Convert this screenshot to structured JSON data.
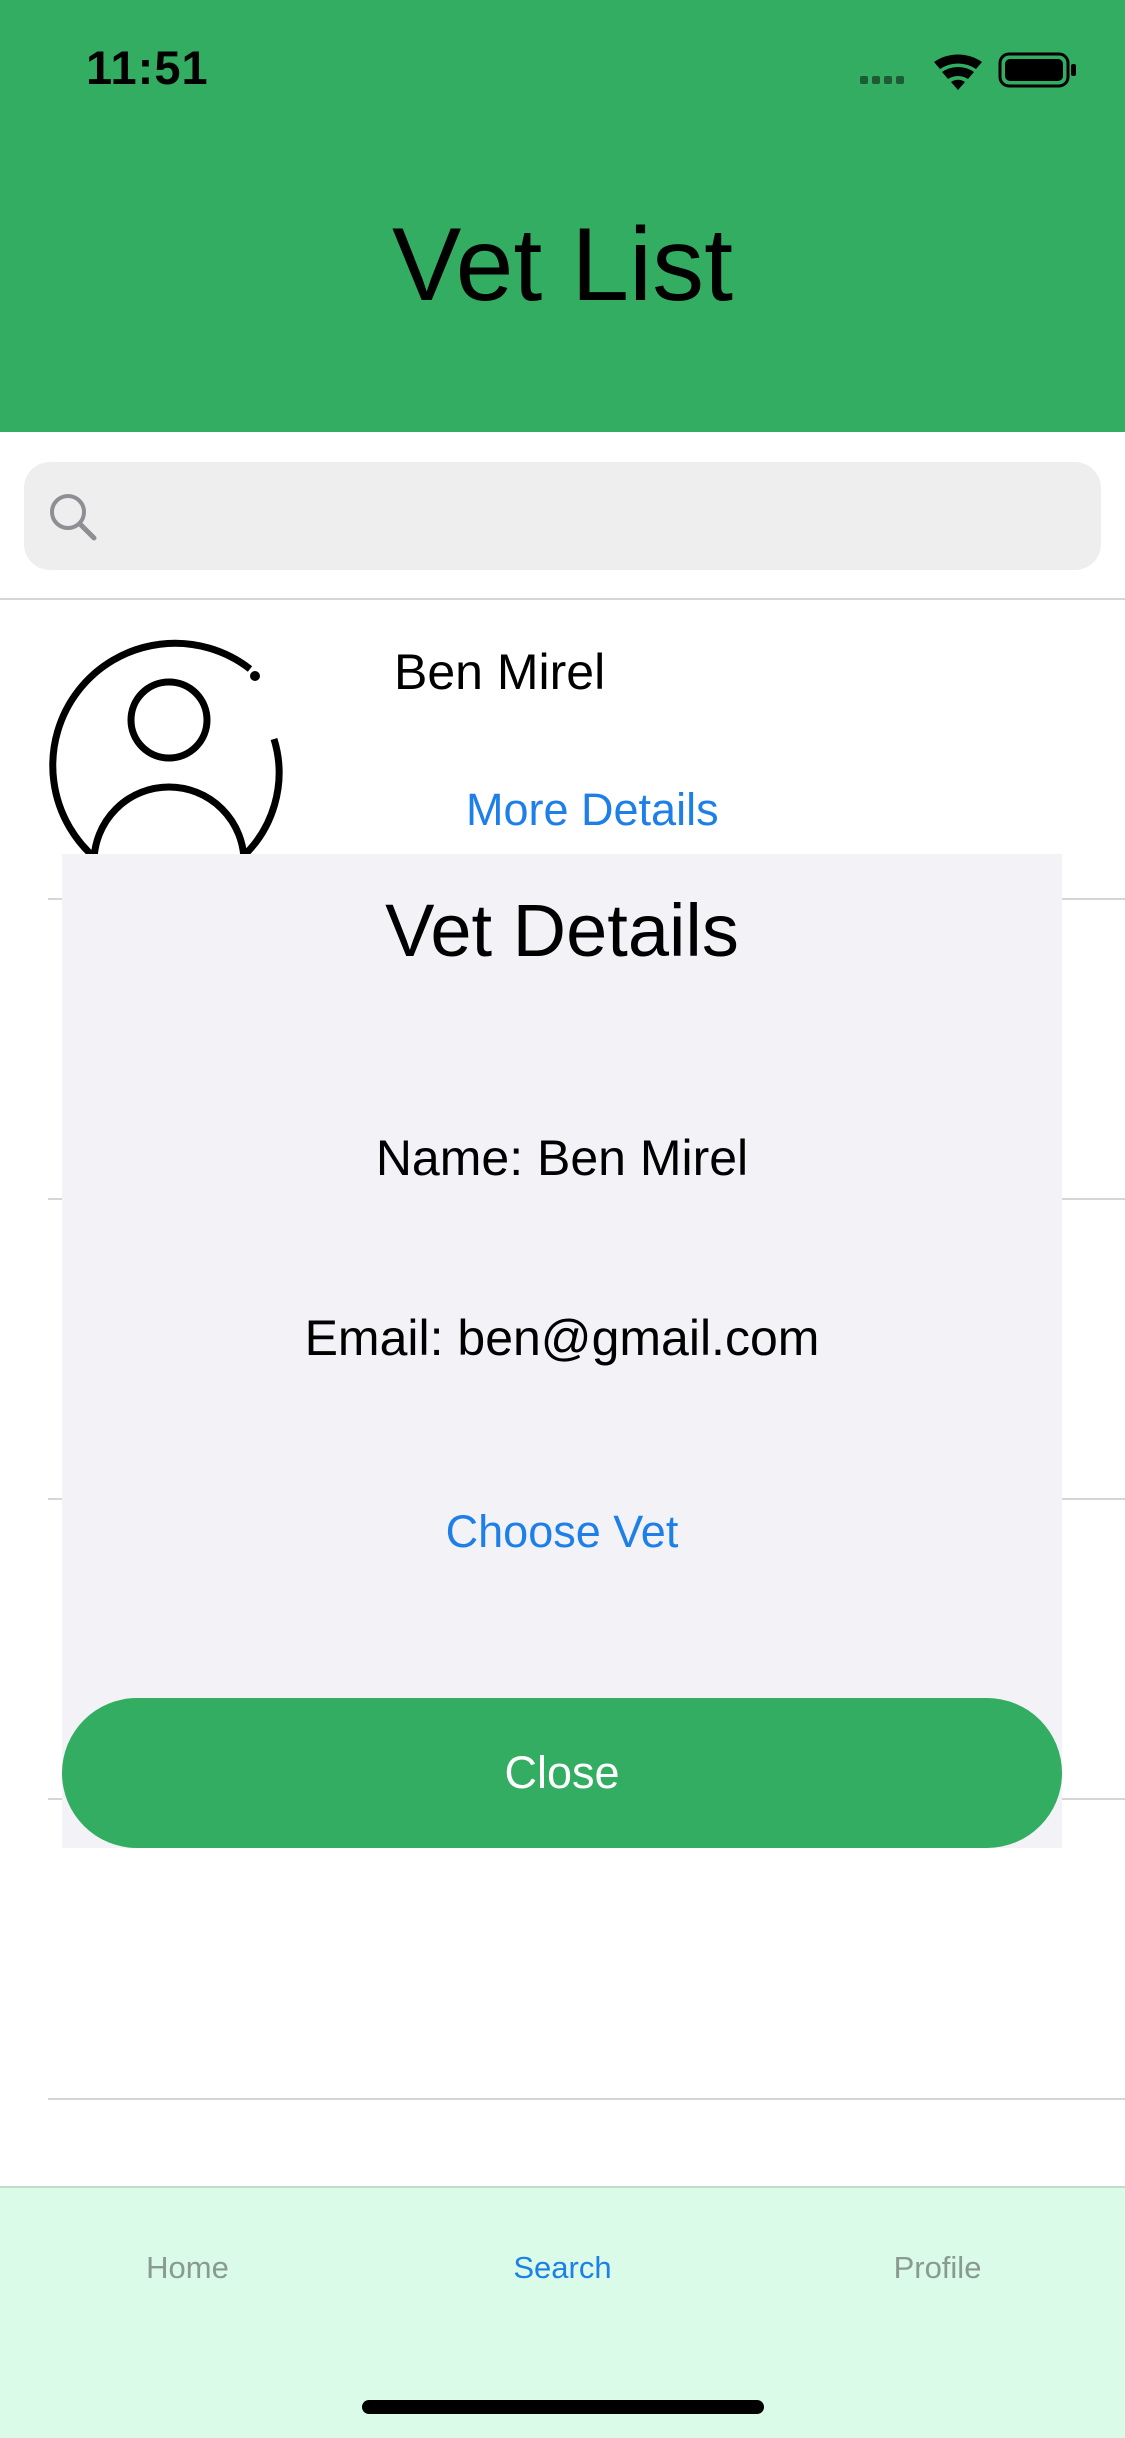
{
  "status_bar": {
    "time": "11:51"
  },
  "header": {
    "title": "Vet List",
    "background_color": "#33AD62"
  },
  "search": {
    "placeholder": "",
    "value": ""
  },
  "vet_list": [
    {
      "name": "Ben Mirel",
      "more_details_label": "More Details"
    }
  ],
  "modal": {
    "title": "Vet Details",
    "name_line": "Name: Ben Mirel",
    "email_line": "Email: ben@gmail.com",
    "choose_label": "Choose Vet",
    "close_label": "Close"
  },
  "tab_bar": {
    "tabs": [
      {
        "label": "Home",
        "active": false
      },
      {
        "label": "Search",
        "active": true
      },
      {
        "label": "Profile",
        "active": false
      }
    ],
    "active_color": "#1E7FE8",
    "background_color": "#D9FBE8"
  },
  "colors": {
    "accent_green": "#33AD62",
    "link_blue": "#1E7FE8"
  }
}
